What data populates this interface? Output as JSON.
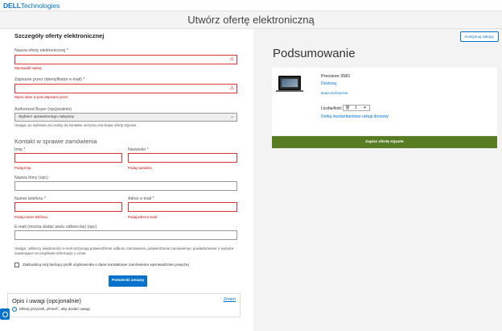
{
  "header": {
    "logo_brand": "DELL",
    "logo_suffix": "Technologies"
  },
  "page": {
    "title": "Utwórz ofertę elektroniczną"
  },
  "form": {
    "section_title": "Szczegóły oferty elektronicznej",
    "quote_name": {
      "label": "Nazwa oferty elektronicznej *",
      "error": "Wprowadź nazwę",
      "value": ""
    },
    "saved_by": {
      "label": "Zapisane przez (identyfikator e-mail) *",
      "error": "Wpisz dane w polu Zapisane przez.",
      "value": ""
    },
    "authorized_buyer": {
      "label": "Authorized Buyer (opcjonalnie)",
      "selected": "Wybierz uprawnionego nabywcę",
      "note": "Uwaga: po wybraniu tej osoby do kontaktu otrzyma ona kopię oferty eQuote."
    },
    "contact_title": "Kontakt w sprawie zamówienia",
    "first_name": {
      "label": "Imię *",
      "error": "Podaj imię.",
      "value": ""
    },
    "last_name": {
      "label": "Nazwisko *",
      "error": "Podaj nazwisko.",
      "value": ""
    },
    "company": {
      "label": "Nazwa firmy (opc)",
      "value": ""
    },
    "phone": {
      "label": "Numer telefonu *",
      "error": "Podaj numer telefonu.",
      "value": ""
    },
    "email": {
      "label": "Adres e-mail *",
      "error": "Podaj adres e-mail.",
      "value": ""
    },
    "extra_emails": {
      "label": "E-mail (można dodać wielu odbiorców) (opc)",
      "value": ""
    },
    "emails_note": "Uwaga: odbiorcy wiadomości e-mail otrzymają potwierdzenie odbioru zamówienia, potwierdzenie zamówienia i powiadomienie o wysyłce zawierające szczegółowe informacje o cenie.",
    "update_profile_label": "Zaktualizuj mój bieżący profil użytkownika o dane kontaktowe zamówienia wprowadzone powyżej",
    "confirm_button": "Potwierdź zmiany"
  },
  "notes": {
    "title": "Opis i uwagi (opcjonalnie)",
    "change_link": "Zmień",
    "info_text": "Kliknij przycisk „Zmień”, aby dodać uwagi"
  },
  "summary": {
    "continue_button": "Kontynuuj zakupy",
    "title": "Podsumowanie",
    "product_name": "Precision 3581",
    "customize_link": "Dostosuj",
    "tech_data_link": "Dane techniczne",
    "qty_label": "Liczba/ilość",
    "qty_value": "1",
    "add_service_link": "Dodaj niestandardowe usługi dostawy",
    "save_button": "Zapisz ofertę eQuote"
  },
  "icons": {
    "warning": "warning-icon",
    "delete": "trash-icon",
    "plus": "plus-icon",
    "info": "info-icon",
    "help": "help-icon",
    "chevron": "chevron-down-icon"
  },
  "colors": {
    "accent": "#0672cb",
    "error": "#cc0000",
    "save": "#587c24"
  }
}
